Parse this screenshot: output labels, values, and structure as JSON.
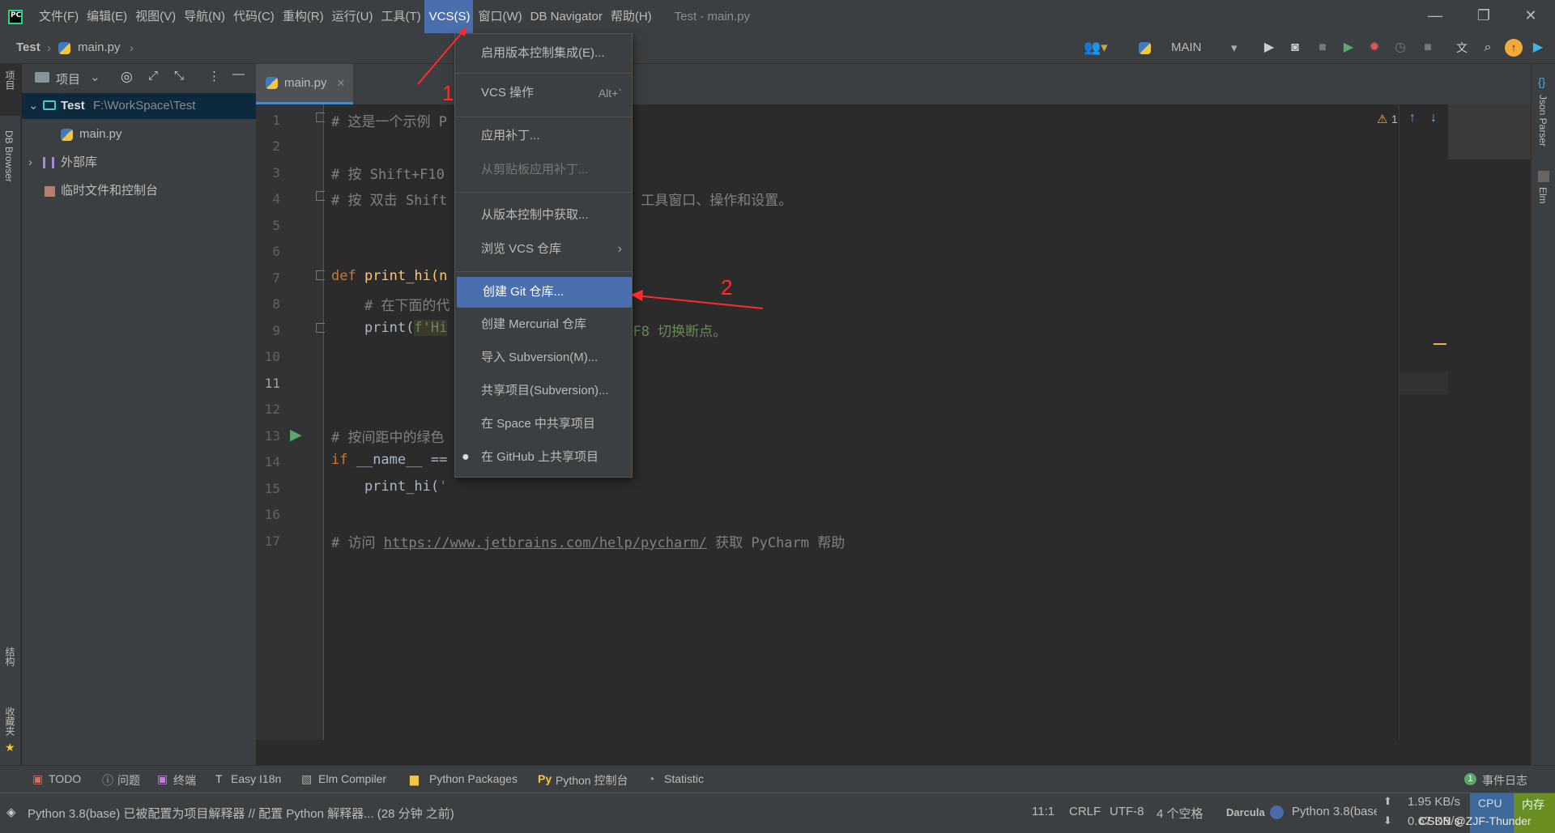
{
  "menubar": {
    "items": [
      "文件(F)",
      "编辑(E)",
      "视图(V)",
      "导航(N)",
      "代码(C)",
      "重构(R)",
      "运行(U)",
      "工具(T)",
      "VCS(S)",
      "窗口(W)",
      "DB Navigator",
      "帮助(H)"
    ],
    "window_title": "Test - main.py"
  },
  "navbar": {
    "project": "Test",
    "file": "main.py",
    "run_config": "MAIN"
  },
  "left_strip": {
    "project_label": "项目",
    "db_browser_label": "DB Browser",
    "structure_label": "结构",
    "favorites_label": "收藏夹"
  },
  "project_panel": {
    "title": "项目",
    "root_name": "Test",
    "root_path": "F:\\WorkSpace\\Test",
    "file": "main.py",
    "external_libs": "外部库",
    "scratches": "临时文件和控制台"
  },
  "editor": {
    "tab": "main.py",
    "warning_count": "1",
    "line_numbers": [
      "1",
      "2",
      "3",
      "4",
      "5",
      "6",
      "7",
      "8",
      "9",
      "10",
      "11",
      "12",
      "13",
      "14",
      "15",
      "16",
      "17"
    ],
    "lines": {
      "l1": "# 这是一个示例 P",
      "l3a": "# 按 Shift+F10",
      "l3b": "。",
      "l4a": "# 按 双击 Shift",
      "l4b": " 工具窗口、操作和设置。",
      "l7kw": "def",
      "l7fn": " print_hi(n",
      "l8": "    # 在下面的代",
      "l8b": "。",
      "l9a": "    print(",
      "l9b": "f'Hi",
      "l9c": "l+F8 切换断点。",
      "l12": "# 按间距中的绿色",
      "l13kw": "if",
      "l13": " __name__ ==",
      "l14a": "    print_hi(",
      "l14b": "'",
      "l16a": "# 访问 ",
      "l16link": "https://www.jetbrains.com/help/pycharm/",
      "l16b": " 获取 PyCharm 帮助"
    }
  },
  "right_strip": {
    "json_parser": "Json Parser",
    "elm": "Elm"
  },
  "vcs_menu": {
    "items": [
      {
        "label": "启用版本控制集成(E)...",
        "shortcut": ""
      },
      {
        "label": "VCS 操作",
        "shortcut": "Alt+`"
      },
      {
        "label": "应用补丁...",
        "shortcut": ""
      },
      {
        "label": "从剪贴板应用补丁...",
        "shortcut": ""
      },
      {
        "label": "从版本控制中获取...",
        "shortcut": ""
      },
      {
        "label": "浏览 VCS 仓库",
        "shortcut": "›"
      },
      {
        "label": "创建 Git 仓库...",
        "shortcut": ""
      },
      {
        "label": "创建 Mercurial 仓库",
        "shortcut": ""
      },
      {
        "label": "导入 Subversion(M)...",
        "shortcut": ""
      },
      {
        "label": "共享项目(Subversion)...",
        "shortcut": ""
      },
      {
        "label": "在 Space 中共享项目",
        "shortcut": ""
      },
      {
        "label": "在 GitHub 上共享项目",
        "shortcut": ""
      }
    ]
  },
  "annotations": {
    "one": "1",
    "two": "2"
  },
  "bottom_tools": [
    "TODO",
    "问题",
    "终端",
    "Easy I18n",
    "Elm Compiler",
    "Python Packages",
    "Python 控制台",
    "Statistic"
  ],
  "event_log": {
    "count": "1",
    "label": "事件日志"
  },
  "status": {
    "message": "Python 3.8(base) 已被配置为项目解释器 // 配置 Python 解释器... (28 分钟 之前)",
    "position": "11:1",
    "line_sep": "CRLF",
    "encoding": "UTF-8",
    "indent": "4 个空格",
    "theme": "Darcula",
    "interpreter": "Python 3.8(base",
    "up_speed": "1.95 KB/s",
    "down_speed": "0.67 KB/s",
    "cpu_label": "CPU",
    "mem_label": "内存",
    "watermark": "CSDN @ZJF-Thunder"
  },
  "colors": {
    "accent": "#4b6eaf",
    "annotation": "#ff2a2a"
  }
}
